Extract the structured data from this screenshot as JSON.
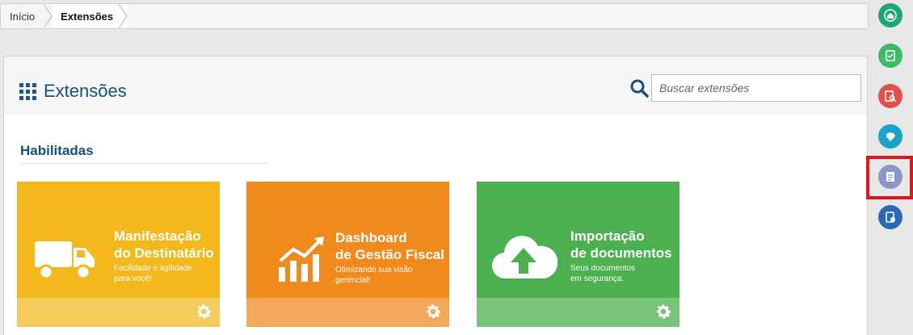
{
  "breadcrumb": {
    "home": "Início",
    "current": "Extensões"
  },
  "header": {
    "title": "Extensões",
    "search_placeholder": "Buscar extensões"
  },
  "section": {
    "title": "Habilitadas"
  },
  "cards": [
    {
      "title": "Manifestação\ndo Destinatário",
      "subtitle": "Facilidade e agilidade\npara você!",
      "color": "#f2b81c",
      "footer_color": "#f5cb5c"
    },
    {
      "title": "Dashboard\nde Gestão Fiscal",
      "subtitle": "Otimizando sua visão\ngerencial!",
      "color": "#f08a1c",
      "footer_color": "#f4a85a"
    },
    {
      "title": "Importação\nde documentos",
      "subtitle": "Seus documentos\nem segurança.",
      "color": "#4caf50",
      "footer_color": "#79c47c"
    }
  ],
  "rail": {
    "icons": [
      "home-icon",
      "document-check-icon",
      "document-search-icon",
      "brazil-map-icon",
      "document-list-icon",
      "document-settings-icon"
    ],
    "colors": [
      "#1ea57a",
      "#3dbb6b",
      "#e0514a",
      "#1aa3c9",
      "#8c95c7",
      "#2a6ab3"
    ]
  }
}
